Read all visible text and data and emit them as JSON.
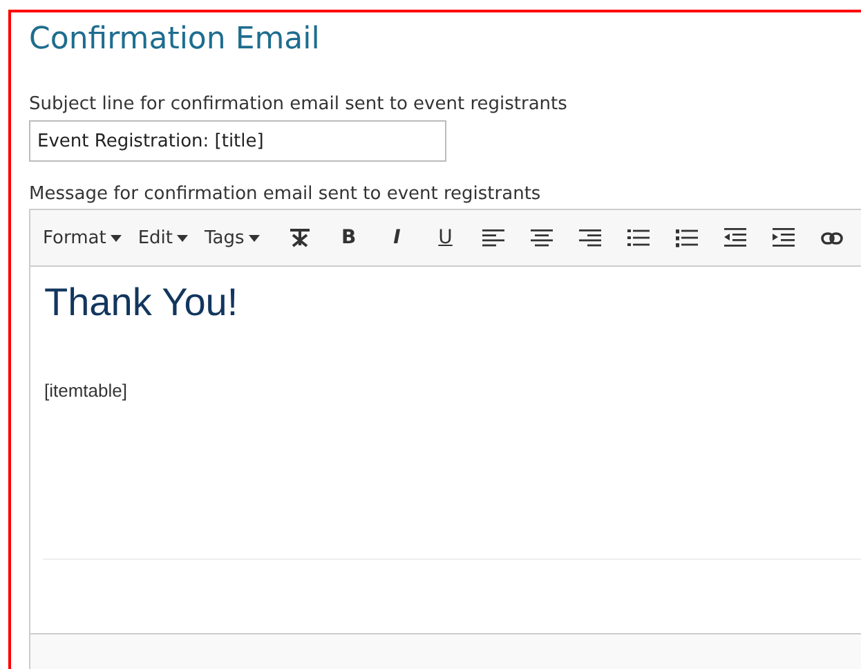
{
  "heading": "Confirmation Email",
  "subject": {
    "label": "Subject line for confirmation email sent to event registrants",
    "value": "Event Registration: [title]"
  },
  "message": {
    "label": "Message for confirmation email sent to event registrants"
  },
  "toolbar": [
    {
      "kind": "menu",
      "label": "Format"
    },
    {
      "kind": "menu",
      "label": "Edit"
    },
    {
      "kind": "menu",
      "label": "Tags"
    },
    {
      "kind": "clear"
    },
    {
      "kind": "bold",
      "label": "B"
    },
    {
      "kind": "italic",
      "label": "I"
    },
    {
      "kind": "underline",
      "label": "U"
    },
    {
      "kind": "alignleft"
    },
    {
      "kind": "aligncenter"
    },
    {
      "kind": "alignright"
    },
    {
      "kind": "bullets"
    },
    {
      "kind": "numbers"
    },
    {
      "kind": "outdent"
    },
    {
      "kind": "indent"
    },
    {
      "kind": "link"
    }
  ],
  "content": [
    {
      "kind": "heading",
      "text": "Thank You!"
    },
    {
      "kind": "paragraph",
      "text": "[itemtable]"
    }
  ]
}
